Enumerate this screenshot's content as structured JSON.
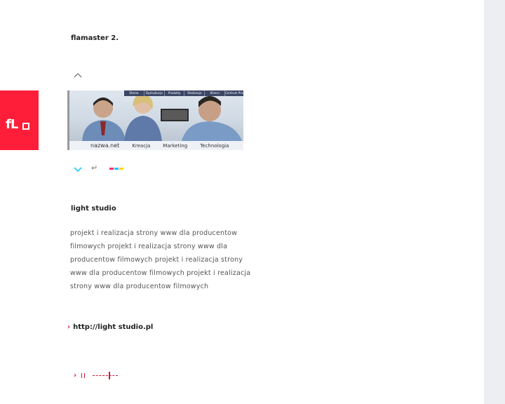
{
  "logo": {
    "text": "fL",
    "icon": "square-outline"
  },
  "header": {
    "title": "flamaster 2."
  },
  "navigation": {
    "up_icon": "chevron-up-icon",
    "down_icon": "chevron-down-icon",
    "return_icon": "return-arrow-icon",
    "return_glyph": "↵",
    "colors": [
      "#ff2a6d",
      "#1ec8ff",
      "#ffd400"
    ]
  },
  "preview": {
    "menu": [
      "Strona",
      "Dystrybucja",
      "Produkty",
      "Realizacje",
      "Klienci",
      "Centrum Prasowe"
    ],
    "footer": [
      "nazwa.net",
      "Kreacja",
      "Marketing",
      "Technologia"
    ]
  },
  "project": {
    "title": "light studio",
    "description": "projekt i realizacja strony www dla producentow filmowych projekt i realizacja strony www dla producentow filmowych projekt i realizacja strony www dla producentow filmowych projekt i realizacja strony www dla producentow filmowych",
    "link_arrow": "›",
    "link": "http://light studio.pl"
  },
  "player": {
    "play_glyph": "›"
  },
  "colors": {
    "brand_red": "#ff1e39",
    "accent_red": "#cc1a36",
    "accent_cyan": "#1ec8ff",
    "side_strip": "#eceef2"
  }
}
